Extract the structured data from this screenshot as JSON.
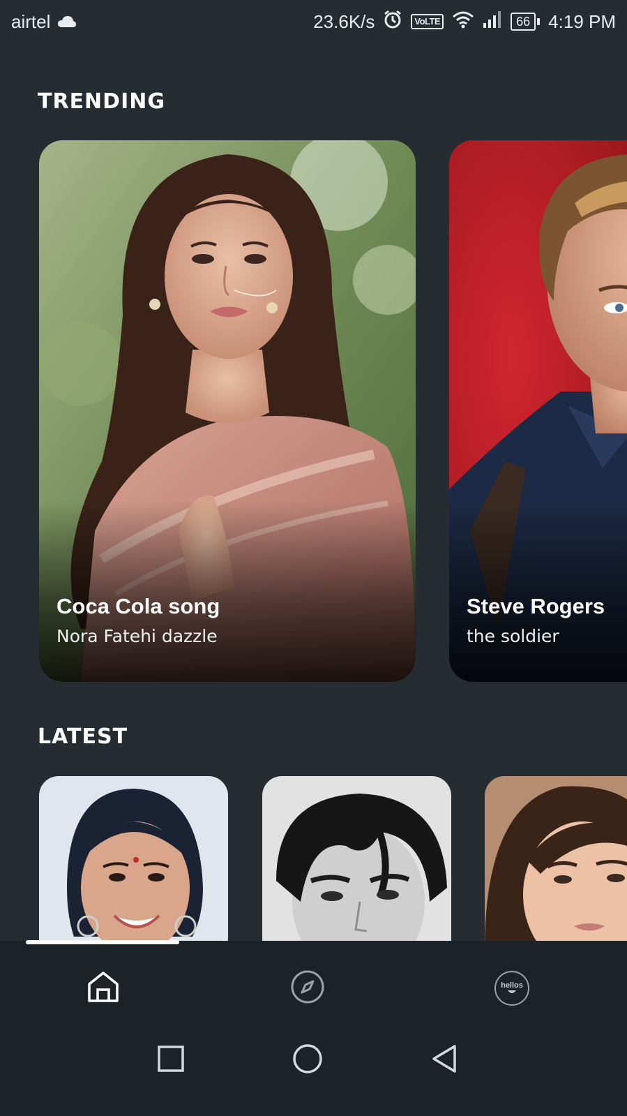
{
  "status_bar": {
    "carrier": "airtel",
    "network_speed": "23.6K/s",
    "volte": "VoLTE",
    "battery": "66",
    "time": "4:19 PM",
    "icons": [
      "cloud-icon",
      "alarm-icon",
      "wifi-icon",
      "signal-icon",
      "battery-icon"
    ]
  },
  "sections": {
    "trending_title": "TRENDING",
    "latest_title": "LATEST"
  },
  "trending": [
    {
      "title": "Coca Cola song",
      "subtitle": "Nora Fatehi dazzle"
    },
    {
      "title": "Steve Rogers",
      "subtitle": "the soldier"
    }
  ],
  "latest_count_visible": 3,
  "bottom_nav": {
    "items": [
      "home-icon",
      "explore-icon",
      "hellos-icon"
    ],
    "hellos_label": "hellos",
    "active": "home"
  },
  "system_nav": [
    "recent-apps-button",
    "home-button",
    "back-button"
  ],
  "colors": {
    "background": "#252d33",
    "nav_background": "#1c2226",
    "text": "#ffffff"
  }
}
